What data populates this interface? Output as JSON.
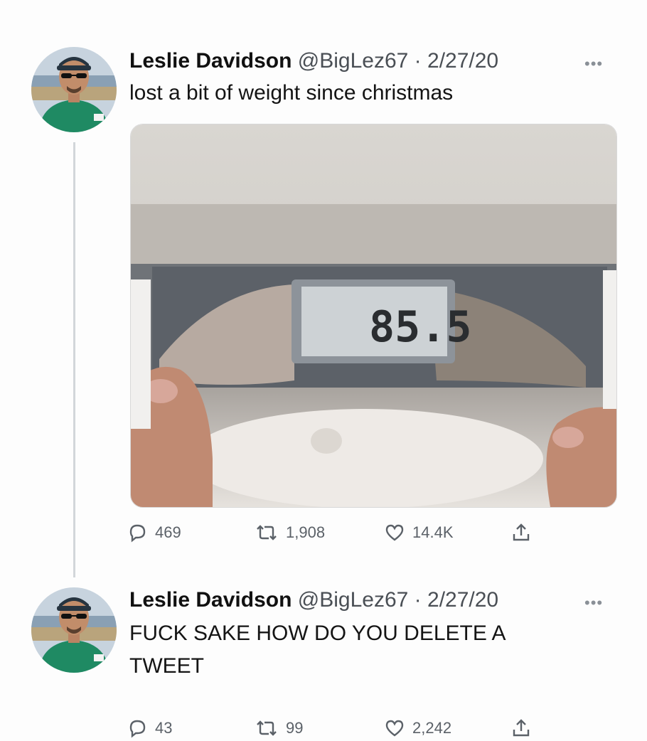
{
  "tweets": [
    {
      "author_name": "Leslie Davidson",
      "handle": "@BigLez67",
      "separator": "·",
      "date": "2/27/20",
      "more_icon": "more-horizontal-icon",
      "text": "lost a bit of weight since christmas",
      "has_photo": true,
      "photo_scale_reading": "85.5",
      "stats": {
        "replies": "469",
        "retweets": "1,908",
        "likes": "14.4K"
      }
    },
    {
      "author_name": "Leslie Davidson",
      "handle": "@BigLez67",
      "separator": "·",
      "date": "2/27/20",
      "more_icon": "more-horizontal-icon",
      "text": "FUCK SAKE HOW DO YOU DELETE A TWEET",
      "has_photo": false,
      "stats": {
        "replies": "43",
        "retweets": "99",
        "likes": "2,242"
      }
    }
  ],
  "icons": {
    "reply": "reply-icon",
    "retweet": "retweet-icon",
    "like": "heart-icon",
    "share": "share-icon"
  },
  "colors": {
    "text": "#141414",
    "secondary": "#4a4f55",
    "icon": "#5b6168",
    "thread_line": "#d2d6da",
    "avatar_shirt": "#1f8a63"
  }
}
